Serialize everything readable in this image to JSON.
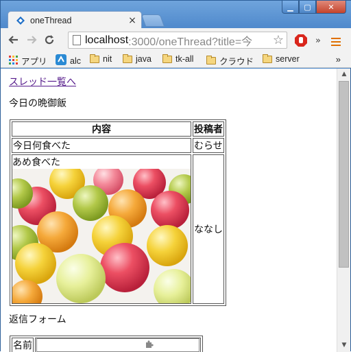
{
  "browser": {
    "tab_title": "oneThread",
    "tab_close": "×",
    "url_host": "localhost",
    "url_path": ":3000/oneThread?title=今",
    "window_buttons": {
      "minimize": "▁",
      "maximize": "▢",
      "close": "✕"
    }
  },
  "bookmarks": [
    {
      "label": "アプリ",
      "icon": "apps-grid-icon"
    },
    {
      "label": "alc",
      "icon": "alc-icon"
    },
    {
      "label": "nit",
      "icon": "folder-icon"
    },
    {
      "label": "java",
      "icon": "folder-icon"
    },
    {
      "label": "tk-all",
      "icon": "folder-icon"
    },
    {
      "label": "クラウド",
      "icon": "folder-icon"
    },
    {
      "label": "server",
      "icon": "folder-icon"
    }
  ],
  "bookmarks_more": "»",
  "toolbar_more": "»",
  "page": {
    "back_link": "スレッド一覧へ",
    "thread_title": "今日の晩御飯",
    "table": {
      "headers": [
        "内容",
        "投稿者"
      ],
      "rows": [
        {
          "content": "今日何食べた",
          "author": "むらせ"
        },
        {
          "content": "あめ食べた",
          "author": "ななし",
          "has_image": true,
          "image_desc": "candy-photo"
        }
      ]
    },
    "reply_title": "返信フォーム",
    "form": {
      "name_label": "名前"
    }
  },
  "colors": {
    "link_visited": "#551a8b",
    "chrome_frame": "#4a86c8",
    "tab_bg": "#f2f2f2"
  }
}
